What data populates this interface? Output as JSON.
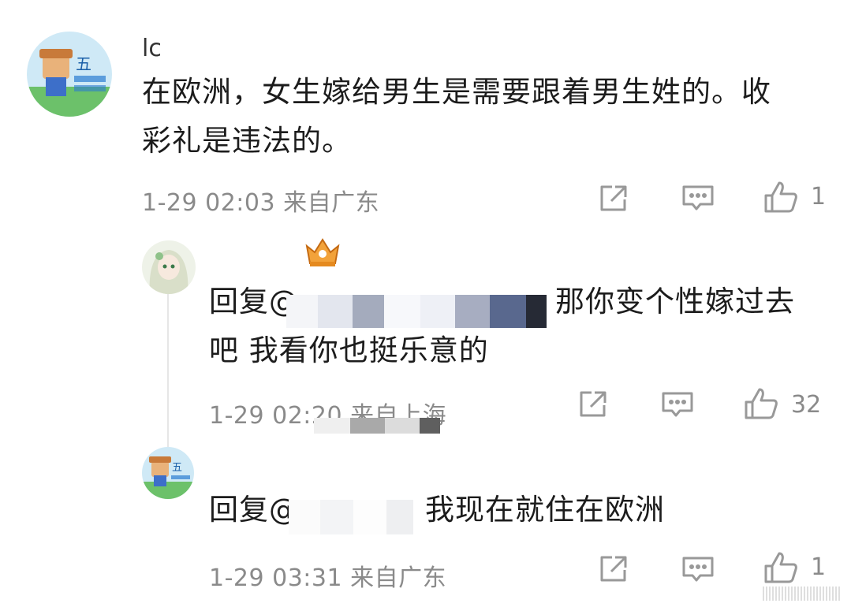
{
  "comments": [
    {
      "username": "lc",
      "text_line1": "在欧洲，女生嫁给男生是需要跟着男生姓的。收",
      "text_line2": "彩礼是违法的。",
      "meta": "1-29 02:03 来自广东",
      "likes": "1"
    },
    {
      "reply_prefix": "回复@",
      "text_line1_tail": "那你变个性嫁过去",
      "text_line2": "吧 我看你也挺乐意的",
      "meta": "1-29 02:20 来自上海",
      "likes": "32"
    },
    {
      "reply_prefix": "回复@",
      "text_tail": "我现在就住在欧洲",
      "meta": "1-29 03:31 来自广东",
      "likes": "1"
    }
  ],
  "colors": {
    "meta_gray": "#8a8a8a",
    "icon_gray": "#999999",
    "text": "#1c1c1c",
    "thread_line": "#e6e6e6"
  },
  "icons": {
    "share": "share-icon",
    "comment": "comment-icon",
    "like": "thumbs-up-icon",
    "badge": "crown-badge-icon"
  }
}
